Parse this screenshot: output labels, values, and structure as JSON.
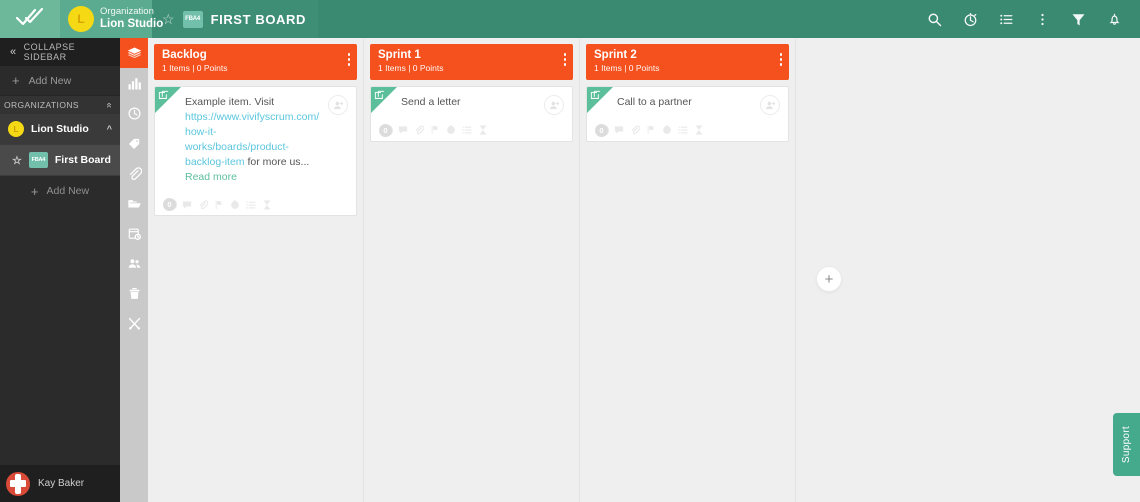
{
  "topbar": {
    "logo_icon": "double-check-icon",
    "org_label": "Organization",
    "org_name": "Lion Studio",
    "org_initial": "L",
    "star_glyph": "☆",
    "board_badge": "FBA4",
    "board_title": "FIRST BOARD",
    "icons": [
      {
        "name": "search-icon",
        "label": "Search"
      },
      {
        "name": "stopwatch-icon",
        "label": "Time tracking"
      },
      {
        "name": "list-icon",
        "label": "List view"
      },
      {
        "name": "more-vertical-icon",
        "label": "More options"
      },
      {
        "name": "filter-icon",
        "label": "Filter"
      },
      {
        "name": "bell-icon",
        "label": "Notifications"
      }
    ],
    "colors": {
      "bar": "#3a8a72",
      "logo_bg": "#6db79b",
      "org_bg": "#5aab90"
    }
  },
  "sidebar": {
    "collapse_label": "COLLAPSE SIDEBAR",
    "collapse_chevron": "«",
    "add_new_top": "Add New",
    "organizations_header": "ORGANIZATIONS",
    "organizations_chevron": "«",
    "organization": {
      "initial": "L",
      "name": "Lion Studio",
      "chevron": "^"
    },
    "board": {
      "badge": "FBA4",
      "name": "First Board",
      "star": "☆"
    },
    "add_new_board": "Add New",
    "user": {
      "name": "Kay Baker",
      "avatar": "user-avatar"
    }
  },
  "icon_strip": {
    "items": [
      {
        "name": "layers-icon",
        "active": true
      },
      {
        "name": "bar-chart-icon",
        "active": false
      },
      {
        "name": "history-clock-icon",
        "active": false
      },
      {
        "name": "tag-icon",
        "active": false
      },
      {
        "name": "paperclip-icon",
        "active": false
      },
      {
        "name": "folder-icon",
        "active": false
      },
      {
        "name": "calendar-clock-icon",
        "active": false
      },
      {
        "name": "users-icon",
        "active": false
      },
      {
        "name": "trash-icon",
        "active": false
      },
      {
        "name": "tools-icon",
        "active": false
      }
    ],
    "active_color": "#f4511e",
    "bg_color": "#c9c9c9"
  },
  "board": {
    "add_column_glyph": "+",
    "column_header_color": "#f4511e",
    "columns": [
      {
        "title": "Backlog",
        "meta": "1 Items | 0 Points",
        "cards": [
          {
            "text_before": "Example item. Visit ",
            "link": "https://www.vivifyscrum.com/how-it-works/boards/product-backlog-item",
            "text_after": " for more us...",
            "read_more": "Read more",
            "points": "0",
            "footer_icons": [
              "comment-icon",
              "paperclip-icon",
              "flag-icon",
              "clock-icon",
              "list-icon",
              "hourglass-icon"
            ],
            "assign_icon": "add-user-icon",
            "ribbon_icon": "book-icon"
          }
        ]
      },
      {
        "title": "Sprint 1",
        "meta": "1 Items | 0 Points",
        "cards": [
          {
            "text_before": "Send a letter",
            "link": "",
            "text_after": "",
            "read_more": "",
            "points": "0",
            "footer_icons": [
              "comment-icon",
              "paperclip-icon",
              "flag-icon",
              "clock-icon",
              "list-icon",
              "hourglass-icon"
            ],
            "assign_icon": "add-user-icon",
            "ribbon_icon": "book-icon"
          }
        ]
      },
      {
        "title": "Sprint 2",
        "meta": "1 Items | 0 Points",
        "cards": [
          {
            "text_before": "Call to a partner",
            "link": "",
            "text_after": "",
            "read_more": "",
            "points": "0",
            "footer_icons": [
              "comment-icon",
              "paperclip-icon",
              "flag-icon",
              "clock-icon",
              "list-icon",
              "hourglass-icon"
            ],
            "assign_icon": "add-user-icon",
            "ribbon_icon": "book-icon"
          }
        ]
      }
    ]
  },
  "support": {
    "label": "Support",
    "color": "#45a98c"
  }
}
